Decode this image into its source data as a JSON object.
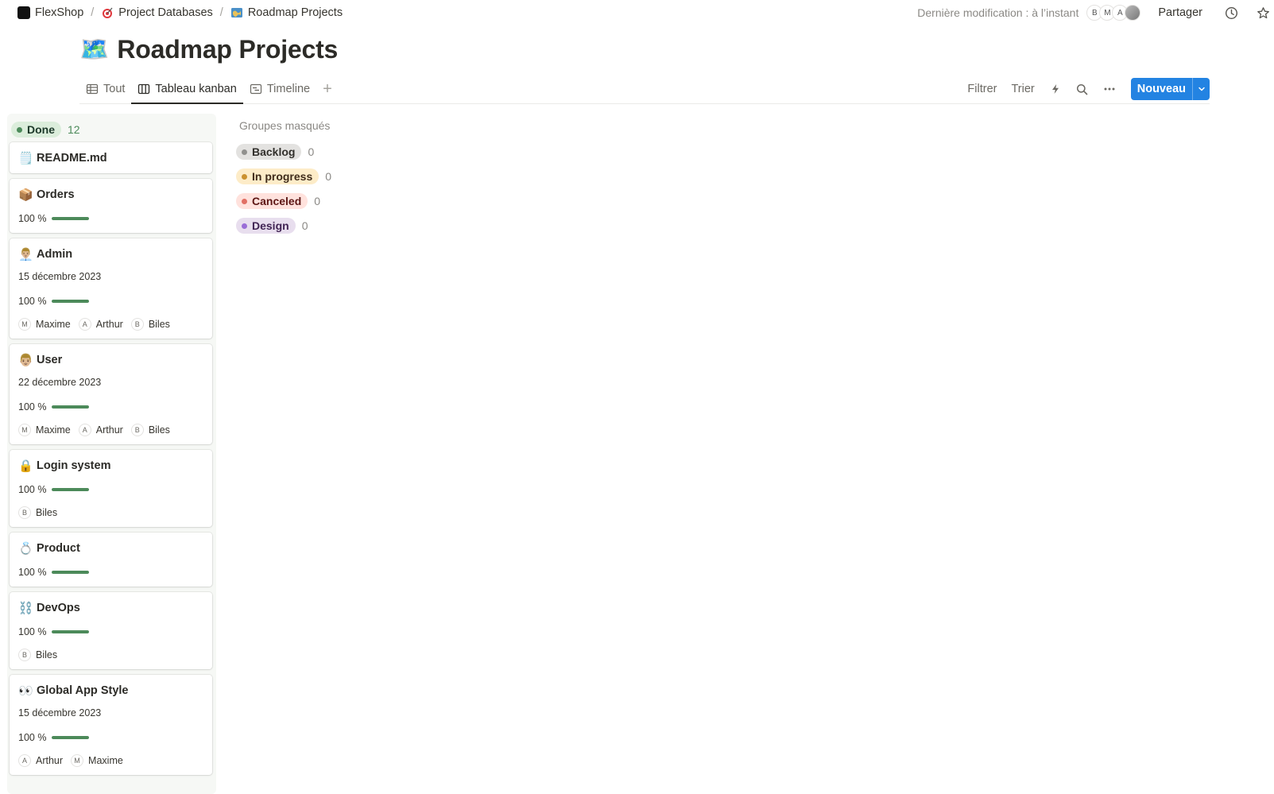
{
  "breadcrumbs": [
    {
      "icon": "flexshop-logo",
      "label": "FlexShop"
    },
    {
      "icon": "target-icon",
      "label": "Project Databases"
    },
    {
      "icon": "map-icon",
      "label": "Roadmap Projects"
    }
  ],
  "topbar": {
    "last_modified": "Dernière modification : à l’instant",
    "avatars": [
      "B",
      "M",
      "A"
    ],
    "share_label": "Partager"
  },
  "page": {
    "emoji": "🗺️",
    "title": "Roadmap Projects"
  },
  "views": {
    "tabs": [
      {
        "icon": "table-icon",
        "label": "Tout"
      },
      {
        "icon": "board-icon",
        "label": "Tableau kanban"
      },
      {
        "icon": "timeline-icon",
        "label": "Timeline"
      }
    ],
    "active_tab": "Tableau kanban",
    "filter_label": "Filtrer",
    "sort_label": "Trier",
    "new_label": "Nouveau"
  },
  "board": {
    "column": {
      "label": "Done",
      "count": "12",
      "color": "#4c8a5a",
      "bg": "#dbeddb"
    },
    "cards": [
      {
        "emoji": "🗒️",
        "title": "README.md"
      },
      {
        "emoji": "📦",
        "title": "Orders",
        "progress": "100 %",
        "progress_value": 1.0
      },
      {
        "emoji": "👨🏼‍💼",
        "title": "Admin",
        "date": "15 décembre 2023",
        "progress": "100 %",
        "progress_value": 1.0,
        "people": [
          {
            "initial": "M",
            "name": "Maxime"
          },
          {
            "initial": "A",
            "name": "Arthur"
          },
          {
            "initial": "B",
            "name": "Biles"
          }
        ]
      },
      {
        "emoji": "👨🏼",
        "title": "User",
        "date": "22 décembre 2023",
        "progress": "100 %",
        "progress_value": 1.0,
        "people": [
          {
            "initial": "M",
            "name": "Maxime"
          },
          {
            "initial": "A",
            "name": "Arthur"
          },
          {
            "initial": "B",
            "name": "Biles"
          }
        ]
      },
      {
        "emoji": "🔒",
        "title": "Login system",
        "progress": "100 %",
        "progress_value": 1.0,
        "people": [
          {
            "initial": "B",
            "name": "Biles"
          }
        ]
      },
      {
        "emoji": "💍",
        "title": "Product",
        "progress": "100 %",
        "progress_value": 1.0
      },
      {
        "emoji": "⛓️",
        "title": "DevOps",
        "progress": "100 %",
        "progress_value": 1.0,
        "people": [
          {
            "initial": "B",
            "name": "Biles"
          }
        ]
      },
      {
        "emoji": "👀",
        "title": "Global App Style",
        "date": "15 décembre 2023",
        "progress": "100 %",
        "progress_value": 1.0,
        "people": [
          {
            "initial": "A",
            "name": "Arthur"
          },
          {
            "initial": "M",
            "name": "Maxime"
          }
        ]
      }
    ]
  },
  "hidden_groups": {
    "title": "Groupes masqués",
    "groups": [
      {
        "label": "Backlog",
        "count": "0",
        "dot": "#91918e",
        "bg": "#e3e2e0",
        "text": "#32302c"
      },
      {
        "label": "In progress",
        "count": "0",
        "dot": "#cb912f",
        "bg": "#fdecc8",
        "text": "#402c1b"
      },
      {
        "label": "Canceled",
        "count": "0",
        "dot": "#e16f64",
        "bg": "#ffe2dd",
        "text": "#5d1715"
      },
      {
        "label": "Design",
        "count": "0",
        "dot": "#9a6dd7",
        "bg": "#e8deee",
        "text": "#412454"
      }
    ]
  }
}
